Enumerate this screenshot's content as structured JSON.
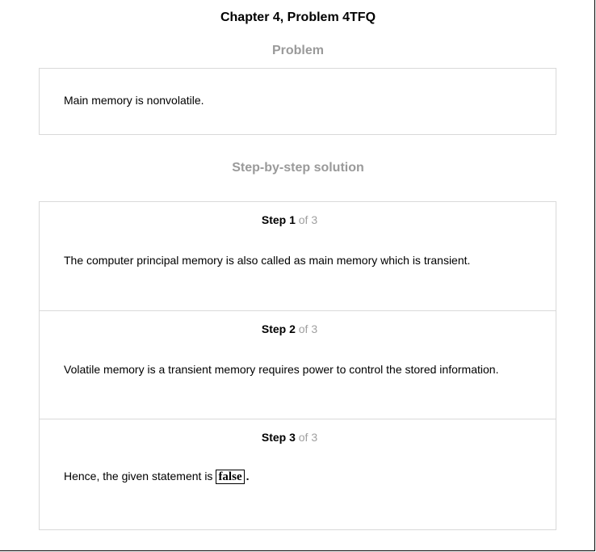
{
  "header": {
    "title": "Chapter 4, Problem 4TFQ"
  },
  "problem": {
    "heading": "Problem",
    "text": "Main memory is nonvolatile."
  },
  "solution": {
    "heading": "Step-by-step solution",
    "steps": [
      {
        "label": "Step 1",
        "of_text": "of 3",
        "text": "The computer principal memory is also called as main memory which is transient."
      },
      {
        "label": "Step 2",
        "of_text": "of 3",
        "text": "Volatile memory is a transient memory requires power to control the stored information."
      },
      {
        "label": "Step 3",
        "of_text": "of 3",
        "text": "Hence, the given statement is",
        "answer": "false",
        "end_punct": "."
      }
    ]
  }
}
